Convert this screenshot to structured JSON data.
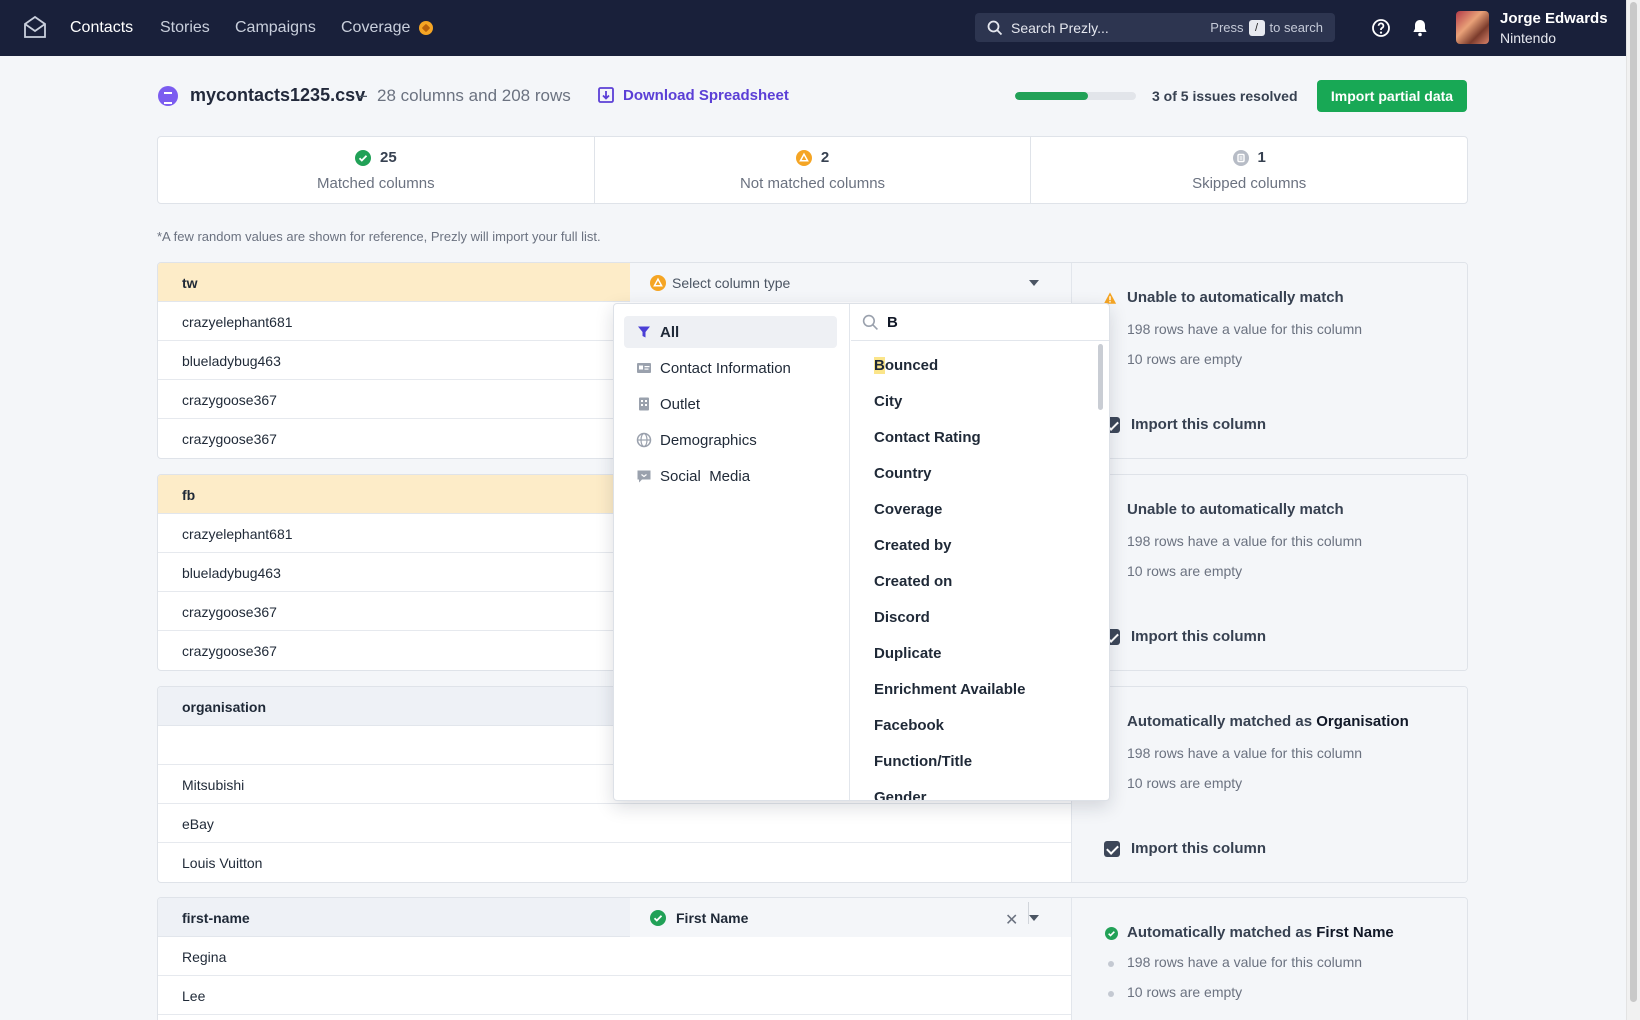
{
  "nav": {
    "items": [
      "Contacts",
      "Stories",
      "Campaigns",
      "Coverage"
    ],
    "active": "Contacts"
  },
  "search": {
    "placeholder": "Search Prezly...",
    "hint_pre": "Press",
    "hint_key": "/",
    "hint_post": "to search"
  },
  "user": {
    "name": "Jorge Edwards",
    "org": "Nintendo"
  },
  "file": {
    "name": "mycontacts1235.csv",
    "separator": "–",
    "meta": "28 columns and 208 rows",
    "download_label": "Download Spreadsheet"
  },
  "progress": {
    "resolved": 3,
    "total": 5,
    "fraction": 0.6,
    "label": "3 of 5 issues resolved"
  },
  "import_button": "Import partial data",
  "stats": [
    {
      "count": "25",
      "label": "Matched columns",
      "status": "matched",
      "color": "#21a157"
    },
    {
      "count": "2",
      "label": "Not matched columns",
      "status": "warning",
      "color": "#f5a524"
    },
    {
      "count": "1",
      "label": "Skipped columns",
      "status": "skipped",
      "color": "#b7bcc6"
    }
  ],
  "note": "*A few random values are shown for reference, Prezly will import your full list.",
  "columns": [
    {
      "name": "tw",
      "select_placeholder": "Select column type",
      "rows": [
        "crazyelephant681",
        "blueladybug463",
        "crazygoose367",
        "crazygoose367"
      ],
      "side": {
        "title": "Unable to automatically match",
        "line1": "198 rows have a value for this column",
        "line2": "10 rows are empty",
        "import_label": "Import this column"
      }
    },
    {
      "name": "fb",
      "rows": [
        "crazyelephant681",
        "blueladybug463",
        "crazygoose367",
        "crazygoose367"
      ],
      "side": {
        "title": "Unable to automatically match",
        "line1": "198 rows have a value for this column",
        "line2": "10 rows are empty",
        "import_label": "Import this column"
      }
    },
    {
      "name": "organisation",
      "rows": [
        "",
        "Mitsubishi",
        "eBay",
        "Louis Vuitton"
      ],
      "side": {
        "title_pre": "Automatically matched as",
        "title_match": "Organisation",
        "line1": "198 rows have a value for this column",
        "line2": "10 rows are empty",
        "import_label": "Import this column"
      }
    },
    {
      "name": "first-name",
      "selected_type": "First Name",
      "rows": [
        "Regina",
        "Lee"
      ],
      "side": {
        "title_pre": "Automatically matched as",
        "title_match": "First Name",
        "line1": "198 rows have a value for this column",
        "line2": "10 rows are empty"
      }
    }
  ],
  "dropdown": {
    "categories": [
      "All",
      "Contact Information",
      "Outlet",
      "Demographics",
      "Social  Media"
    ],
    "active_category": "All",
    "query": "B",
    "options": [
      "Bounced",
      "City",
      "Contact Rating",
      "Country",
      "Coverage",
      "Created by",
      "Created on",
      "Discord",
      "Duplicate",
      "Enrichment Available",
      "Facebook",
      "Function/Title",
      "Gender"
    ],
    "highlight_first_letter": "B",
    "highlight_rest": "ounced"
  }
}
